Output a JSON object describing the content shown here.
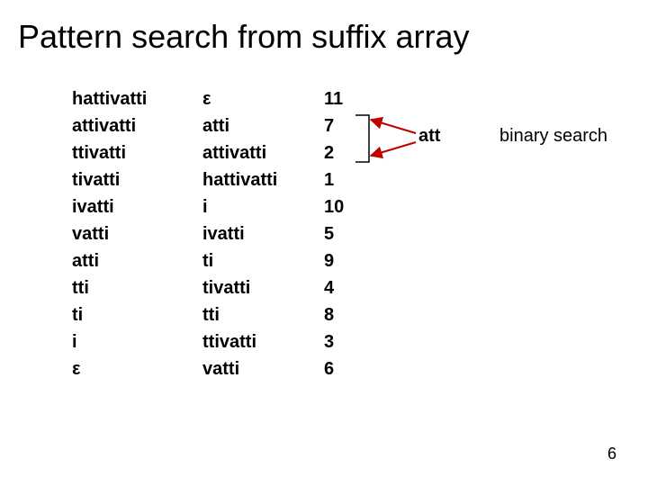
{
  "title": "Pattern search from suffix array",
  "left_col": [
    "hattivatti",
    "attivatti",
    "ttivatti",
    "tivatti",
    "ivatti",
    "vatti",
    "atti",
    "tti",
    "ti",
    "i",
    "ε"
  ],
  "mid_col": [
    "ε",
    "atti",
    "attivatti",
    "hattivatti",
    "i",
    "ivatti",
    "ti",
    "tivatti",
    "tti",
    "ttivatti",
    "vatti"
  ],
  "num_col": [
    "11",
    "7",
    "2",
    "1",
    "10",
    "5",
    "9",
    "4",
    "8",
    "3",
    "6"
  ],
  "pattern_label": "att",
  "binary_label": "binary search",
  "page_number": "6"
}
